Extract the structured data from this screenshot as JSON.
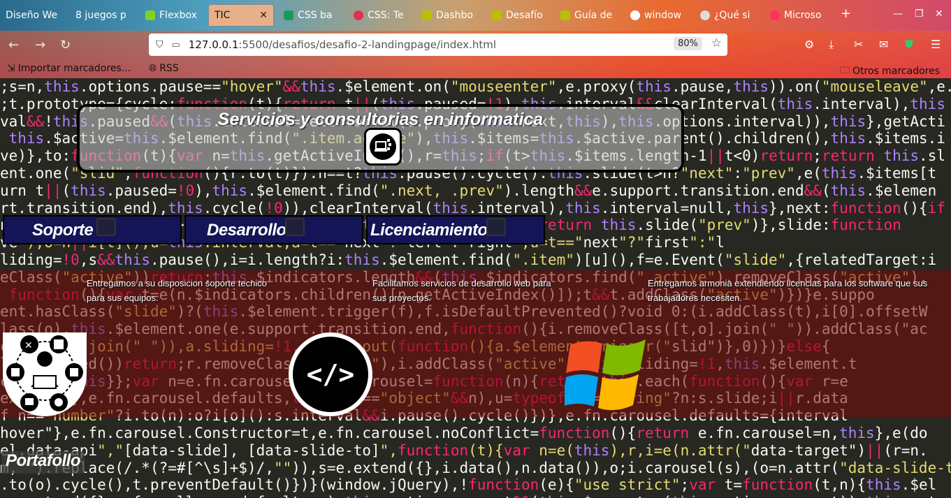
{
  "browser": {
    "tabs": [
      {
        "label": "Diseño We",
        "fav": "#4a90e2"
      },
      {
        "label": "8 juegos p",
        "fav": "#e84a4a"
      },
      {
        "label": "Flexbox",
        "fav": "#7ed321"
      },
      {
        "label": "TIC",
        "fav": "",
        "close": "✕"
      },
      {
        "label": "CSS ba",
        "fav": "#1a9a5a"
      },
      {
        "label": "CSS: Te",
        "fav": "#e03050"
      },
      {
        "label": "Dashbo",
        "fav": "#b8c000"
      },
      {
        "label": "Desafío",
        "fav": "#b8c000"
      },
      {
        "label": "Guía de",
        "fav": "#b8c000"
      },
      {
        "label": "window",
        "fav": "#ffffff"
      },
      {
        "label": "¿Qué si",
        "fav": "#dddddd"
      },
      {
        "label": "Microso",
        "fav": "#ff3060"
      }
    ],
    "new_tab": "+",
    "url": {
      "host": "127.0.0.1",
      "path": ":5500/desafios/desafio-2-landingpage/index.html"
    },
    "zoom": "80%",
    "bookmarks": {
      "import": "Importar marcadores...",
      "rss": "RSS",
      "others": "Otros marcadores"
    }
  },
  "page": {
    "title": "Servicios y consultorias en informatica",
    "nav": [
      {
        "label": "Soporte"
      },
      {
        "label": "Desarrollo"
      },
      {
        "label": "Licenciamiento"
      }
    ],
    "services": [
      {
        "text": "Entregamos a su disposicion soporte tecnico para sus equipos."
      },
      {
        "text": "Facilitamos servicios de desarrollo web para sus proyectos."
      },
      {
        "text": "Entregamos armonia extendiendo licencias para los software que sus trabajadores necesiten."
      }
    ],
    "dev_symbol": "</>",
    "portafolio": "Portafollo"
  },
  "code_lines": [
    ";s=n,this.options.pause==\"hover\"&&this.$element.on(\"mouseenter\",e.proxy(this.pause,this)).on(\"mouseleave\",e.pro",
    ";t.prototype={cycle:function(t){return t||(this.paused=!1),this.interval&&clearInterval(this.interval),this",
    "val&&!this.paused&&(this.interval=setInterval(e.proxy(this.next,this),this.options.interval)),this},getActi",
    " this.$active=this.$element.find(\".item.active\"),this.$items=this.$active.parent().children(),this.$items.i",
    "ve)},to:function(t){var n=this.getActiveIndex(),r=this;if(t>this.$items.length-1||t<0)return;return this.sl",
    "ent.one(\"slid\",function(){r.to(t)}):n==t?this.pause().cycle():this.slide(t>n?\"next\":\"prev\",e(this.$items[t",
    "urn t||(this.paused=!0),this.$element.find(\".next, .prev\").length&&e.support.transition.end&&(this.$elemen",
    "rt.transition.end),this.cycle(!0)),clearInterval(this.interval),this.interval=null,this},next:function(){if",
    "n this.slide(\"next\")},prev:function(){if(this.sliding)return;return this.slide(\"prev\")},slide:function",
    "ve\"),o=n||i[t](),u=this.interval,a=t==\"next\"?\"left\":\"right\",u=t==\"next\"?\"first\":\"l",
    "liding=!0,s&&this.pause(),i=i.length?i:this.$element.find(\".item\")[u](),f=e.Event(\"slide\",{relatedTarget:i",
    "eClass(\"active\"))return;this.$indicators.length&&(this.$indicators.find(\".active\").removeClass(\"active\"),",
    " function(){var t=e(n.$indicators.children()[n.getActiveIndex()]);t&&t.addClass(\"active\")})}e.suppo",
    "ent.hasClass(\"slide\")?(this.$element.trigger(f),f.isDefaultPrevented()?void 0:(i.addClass(t),i[0].offsetW",
    "lass(o),this.$element.one(e.support.transition.end,function(){i.removeClass([t,o].join(\" \")).addClass(\"ac",
    "ctive\",o].join(\" \")),a.sliding=!1,setTimeout(function(){a.$element.trigger(\"slid\")},0)})}else{",
    "ltPrevented())return;r.removeClass(\"active\"),i.addClass(\"active\"),this.sliding=!1,this.$element.t",
    "cycle(),this}};var n=e.fn.carousel;e.fn.carousel=function(n){return this.each(function(){var r=e",
    "extend({},e.fn.carousel.defaults,typeof n==\"object\"&&n),u=typeof n==\"string\"?n:s.slide;i||r.data",
    "f n==\"number\"?i.to(n):o?i[o]():s.interval&&i.pause().cycle()})},e.fn.carousel.defaults={interval",
    "hover\"},e.fn.carousel.Constructor=t,e.fn.carousel.noConflict=function(){return e.fn.carousel=n,this},e(do",
    "el.data-api\",\"[data-slide], [data-slide-to]\",function(t){var n=e(this),r,i=e(n.attr(\"data-target\")||(r=n.",
    "m,\"\").replace(/.*(?=#[^\\s]+$)/,\"\")),s=e.extend({},i.data(),n.data()),o;i.carousel(s),(o=n.attr(\"data-slide-to\"))&&i.d",
    ".to(o).cycle(),t.preventDefault()})}(window.jQuery),!function(e){\"use strict\";var t=function(t,n){this.$el",
    "=e.extend({},e.fn.collapse.defaults,n),this.options.parent&&(this.$parent=e(this.options.parent)),this.opt"
  ]
}
